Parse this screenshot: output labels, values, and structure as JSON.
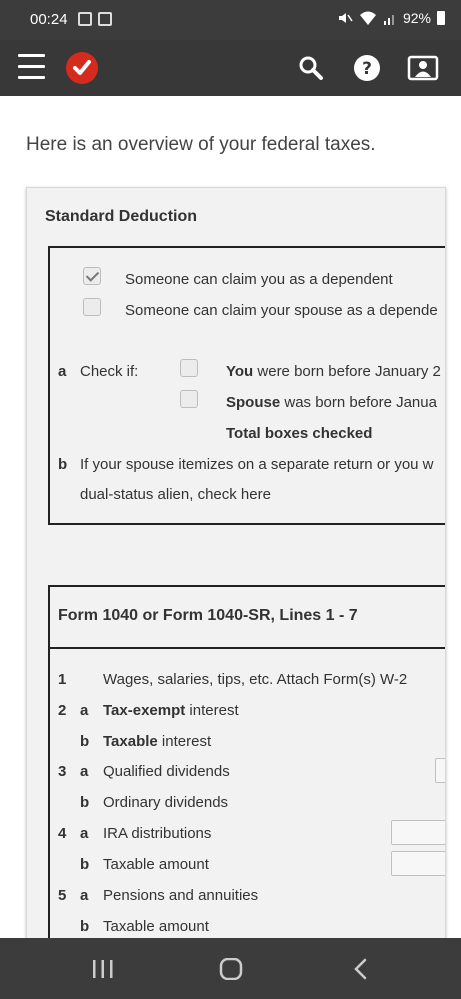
{
  "status_bar": {
    "time": "00:24",
    "battery": "92%",
    "icons": [
      "gallery-icon",
      "image-icon",
      "mute-icon",
      "wifi-icon",
      "signal-icon",
      "battery-icon"
    ]
  },
  "header": {
    "icons": [
      "menu-icon",
      "turbotax-logo",
      "search-icon",
      "help-icon",
      "profile-icon"
    ]
  },
  "intro_text": "Here is an overview of your federal taxes.",
  "standard_deduction": {
    "title": "Standard Deduction",
    "dependent_you": {
      "label": "Someone can claim you as a dependent",
      "checked": true
    },
    "dependent_spouse": {
      "label": "Someone can claim your spouse as a depende",
      "checked": false
    },
    "line_a": {
      "letter": "a",
      "check_if": "Check if:",
      "you_bold": "You",
      "you_rest": "were born before January 2",
      "spouse_bold": "Spouse",
      "spouse_rest": "was born before Janua",
      "total": "Total boxes checked"
    },
    "line_b": {
      "letter": "b",
      "text1": "If your spouse itemizes on a separate return or you w",
      "text2": "dual-status alien, check here"
    }
  },
  "form_lines": {
    "title": "Form 1040 or Form 1040-SR, Lines 1 - 7",
    "rows": [
      {
        "num": "1",
        "sub": "",
        "bold": "",
        "text": "Wages, salaries, tips, etc. Attach Form(s) W-2"
      },
      {
        "num": "2",
        "sub": "a",
        "bold": "Tax-exempt",
        "text": " interest"
      },
      {
        "num": "",
        "sub": "b",
        "bold": "Taxable",
        "text": " interest"
      },
      {
        "num": "3",
        "sub": "a",
        "bold": "",
        "text": "Qualified dividends"
      },
      {
        "num": "",
        "sub": "b",
        "bold": "",
        "text": "Ordinary dividends"
      },
      {
        "num": "4",
        "sub": "a",
        "bold": "",
        "text": "IRA distributions"
      },
      {
        "num": "",
        "sub": "b",
        "bold": "",
        "text": "Taxable amount"
      },
      {
        "num": "5",
        "sub": "a",
        "bold": "",
        "text": "Pensions and annuities"
      },
      {
        "num": "",
        "sub": "b",
        "bold": "",
        "text": "Taxable amount"
      }
    ]
  },
  "nav": {
    "icons": [
      "recent-apps-icon",
      "home-icon",
      "back-icon"
    ]
  }
}
